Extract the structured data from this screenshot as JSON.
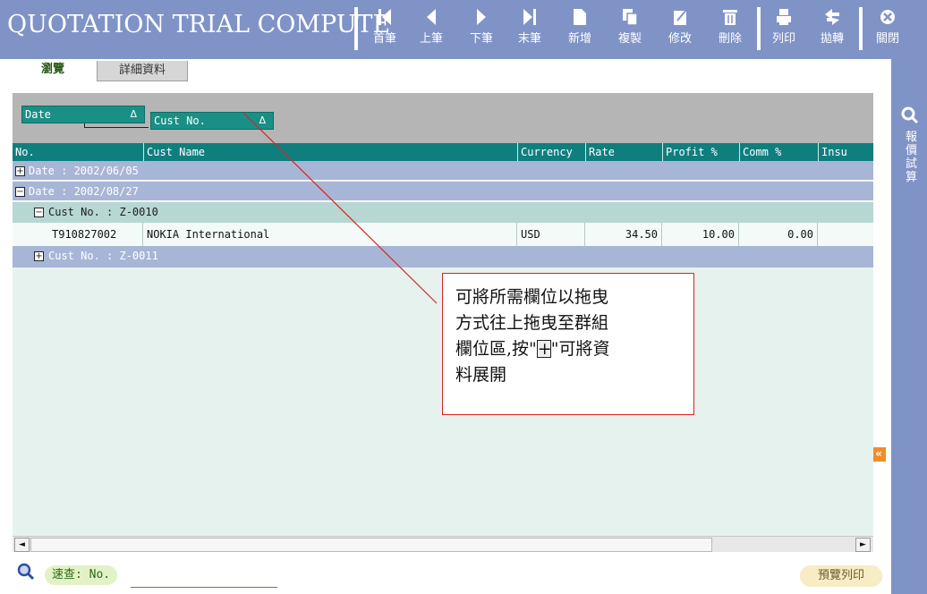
{
  "app": {
    "title": "QUOTATION TRIAL COMPUTE"
  },
  "toolbar": [
    {
      "icon": "first-record-icon",
      "label": "首筆"
    },
    {
      "icon": "previous-record-icon",
      "label": "上筆"
    },
    {
      "icon": "next-record-icon",
      "label": "下筆"
    },
    {
      "icon": "last-record-icon",
      "label": "末筆"
    },
    {
      "icon": "new-document-icon",
      "label": "新增"
    },
    {
      "icon": "copy-icon",
      "label": "複製"
    },
    {
      "icon": "edit-icon",
      "label": "修改"
    },
    {
      "icon": "trash-icon",
      "label": "刪除"
    },
    {
      "icon": "printer-icon",
      "label": "列印"
    },
    {
      "icon": "transfer-icon",
      "label": "拋轉"
    },
    {
      "icon": "close-icon",
      "label": "關閉"
    }
  ],
  "tabs": {
    "browse": "瀏覽",
    "detail": "詳細資料"
  },
  "side_panel": {
    "title": "報價試算",
    "icon": "magnifier-icon"
  },
  "group_area": {
    "chips": [
      {
        "label": "Date",
        "sort": "Δ"
      },
      {
        "label": "Cust No.",
        "sort": "Δ"
      }
    ]
  },
  "columns": [
    "No.",
    "Cust Name",
    "Currency",
    "Rate",
    "Profit %",
    "Comm %",
    "Insu"
  ],
  "groups": {
    "date1": "Date : 2002/06/05",
    "date2": "Date : 2002/08/27",
    "cust1": "Cust No. : Z-0010",
    "cust2": "Cust No. : Z-0011"
  },
  "rows": [
    {
      "no": "T910827002",
      "cust_name": "NOKIA International",
      "currency": "USD",
      "rate": "34.50",
      "profit": "10.00",
      "comm": "0.00"
    }
  ],
  "expander_symbols": {
    "expanded": "−",
    "collapsed": "+"
  },
  "scrollbar": {
    "left_arrow": "◄",
    "right_arrow": "►"
  },
  "collapse_panel_glyph": "«",
  "quick_search": {
    "label": "速查: No.",
    "value": ""
  },
  "print_preview_label": "預覽列印",
  "callout": {
    "line1": "可將所需欄位以拖曳",
    "line2": "方式往上拖曳至群組",
    "line3_prefix": "欄位區,按\"",
    "line3_symbol": "+",
    "line3_suffix": "\"可將資",
    "line4": "料展開"
  },
  "colors": {
    "toolbar_bg": "#7f93c6",
    "grid_header": "#0f7f7e",
    "group_chip": "#1a8f86",
    "callout_border": "#dd2222"
  }
}
